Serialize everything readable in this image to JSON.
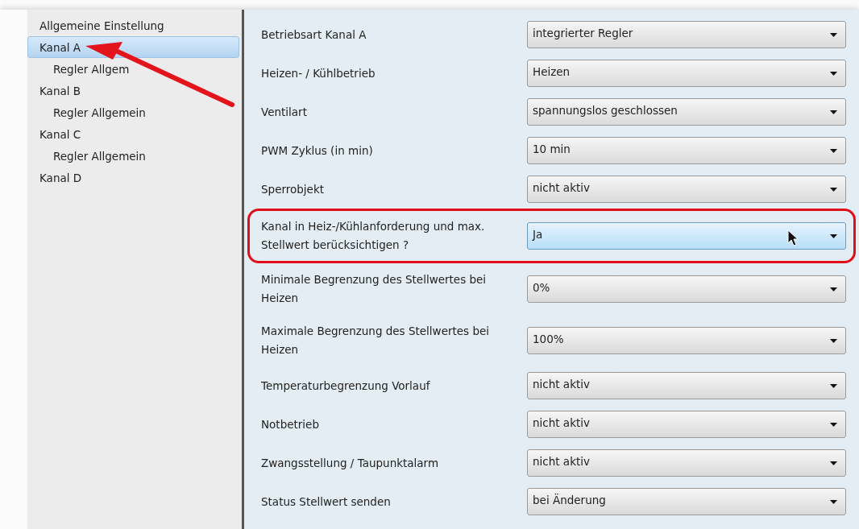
{
  "sidebar": {
    "items": [
      {
        "label": "Allgemeine Einstellung",
        "selected": false
      },
      {
        "label": "Kanal A",
        "selected": true,
        "children": [
          {
            "label": "Regler Allgem",
            "selected": false
          }
        ]
      },
      {
        "label": "Kanal B",
        "selected": false,
        "children": [
          {
            "label": "Regler Allgemein",
            "selected": false
          }
        ]
      },
      {
        "label": "Kanal C",
        "selected": false,
        "children": [
          {
            "label": "Regler Allgemein",
            "selected": false
          }
        ]
      },
      {
        "label": "Kanal D",
        "selected": false
      }
    ]
  },
  "settings": [
    {
      "label": "Betriebsart Kanal A",
      "value": "integrierter Regler",
      "hovered": false,
      "circled": false
    },
    {
      "label": "Heizen- / Kühlbetrieb",
      "value": "Heizen",
      "hovered": false,
      "circled": false
    },
    {
      "label": "Ventilart",
      "value": "spannungslos geschlossen",
      "hovered": false,
      "circled": false
    },
    {
      "label": "PWM Zyklus (in min)",
      "value": "10 min",
      "hovered": false,
      "circled": false
    },
    {
      "label": "Sperrobjekt",
      "value": "nicht aktiv",
      "hovered": false,
      "circled": false
    },
    {
      "label": "Kanal in Heiz-/Kühlanforderung und max. Stellwert berücksichtigen ?",
      "value": "Ja",
      "hovered": true,
      "circled": true
    },
    {
      "label": "Minimale Begrenzung des Stellwertes bei Heizen",
      "value": "0%",
      "hovered": false,
      "circled": false
    },
    {
      "label": "Maximale Begrenzung des Stellwertes bei Heizen",
      "value": "100%",
      "hovered": false,
      "circled": false
    },
    {
      "label": "Temperaturbegrenzung Vorlauf",
      "value": "nicht aktiv",
      "hovered": false,
      "circled": false
    },
    {
      "label": "Notbetrieb",
      "value": "nicht aktiv",
      "hovered": false,
      "circled": false
    },
    {
      "label": "Zwangsstellung / Taupunktalarm",
      "value": "nicht aktiv",
      "hovered": false,
      "circled": false
    },
    {
      "label": "Status Stellwert senden",
      "value": "bei Änderung",
      "hovered": false,
      "circled": false
    }
  ]
}
